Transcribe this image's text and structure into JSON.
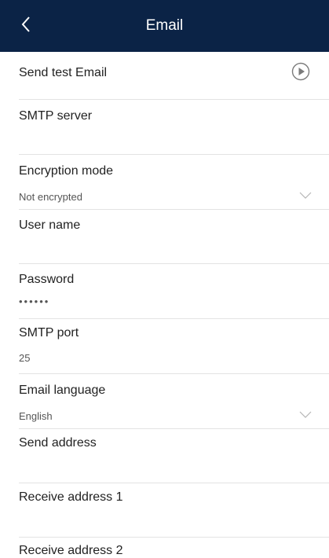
{
  "header": {
    "title": "Email",
    "background": "#0b2346"
  },
  "rows": {
    "send_test": {
      "label": "Send test Email"
    },
    "smtp_server": {
      "label": "SMTP server",
      "value": ""
    },
    "encryption": {
      "label": "Encryption mode",
      "value": "Not encrypted"
    },
    "user_name": {
      "label": "User name",
      "value": ""
    },
    "password": {
      "label": "Password",
      "value": "••••••"
    },
    "smtp_port": {
      "label": "SMTP port",
      "value": "25"
    },
    "language": {
      "label": "Email language",
      "value": "English"
    },
    "send_address": {
      "label": "Send address",
      "value": ""
    },
    "receive_1": {
      "label": "Receive address 1",
      "value": ""
    },
    "receive_2": {
      "label": "Receive address 2",
      "value": ""
    }
  },
  "icons": {
    "back": "chevron-left-icon",
    "send_test": "play-circle-icon",
    "dropdown": "chevron-down-icon"
  }
}
